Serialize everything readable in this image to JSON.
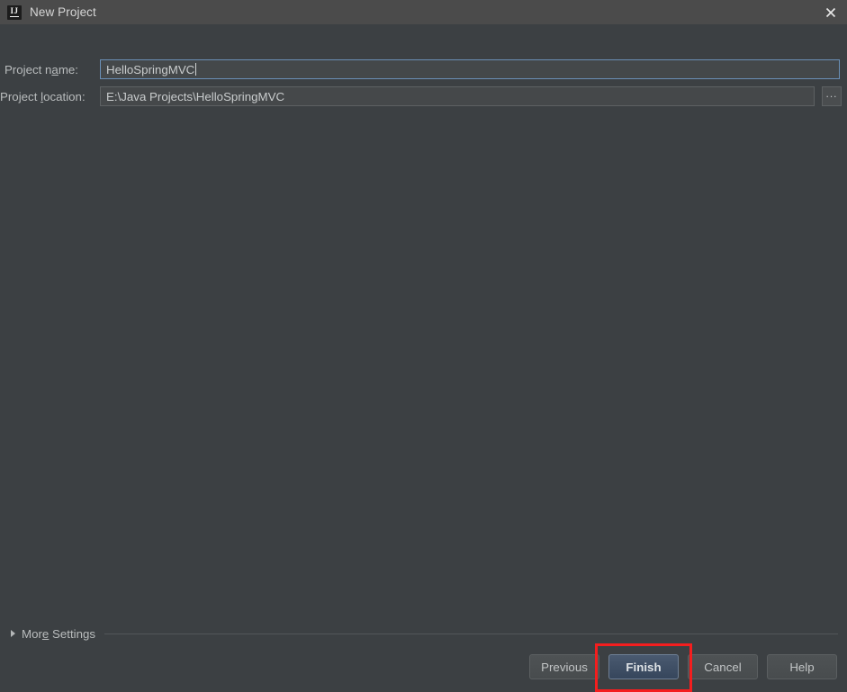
{
  "window": {
    "title": "New Project",
    "app_icon": "intellij-idea-icon",
    "icon_text": "IJ",
    "close_icon": "close-icon",
    "background_color": "#3c4043",
    "titlebar_color": "#4b4b4b"
  },
  "form": {
    "project_name": {
      "label_before": "Project n",
      "label_mnemonic": "a",
      "label_after": "me:",
      "full_label": "Project name:",
      "value": "HelloSpringMVC",
      "focused": true
    },
    "project_location": {
      "label_before": "Project ",
      "label_mnemonic": "l",
      "label_after": "ocation:",
      "full_label": "Project location:",
      "value": "E:\\Java Projects\\HelloSpringMVC",
      "browse_label": "...",
      "browse_icon": "ellipsis-browse-icon"
    }
  },
  "more_settings": {
    "label_before": "Mor",
    "label_mnemonic": "e",
    "label_after": " Settings",
    "full_label": "More Settings",
    "expanded": false,
    "disclosure_icon": "triangle-right-icon"
  },
  "buttons": {
    "previous": "Previous",
    "finish": "Finish",
    "cancel": "Cancel",
    "help": "Help"
  },
  "annotation": {
    "target": "finish-button",
    "color": "#f41e1e",
    "style": "rectangle-outline"
  }
}
